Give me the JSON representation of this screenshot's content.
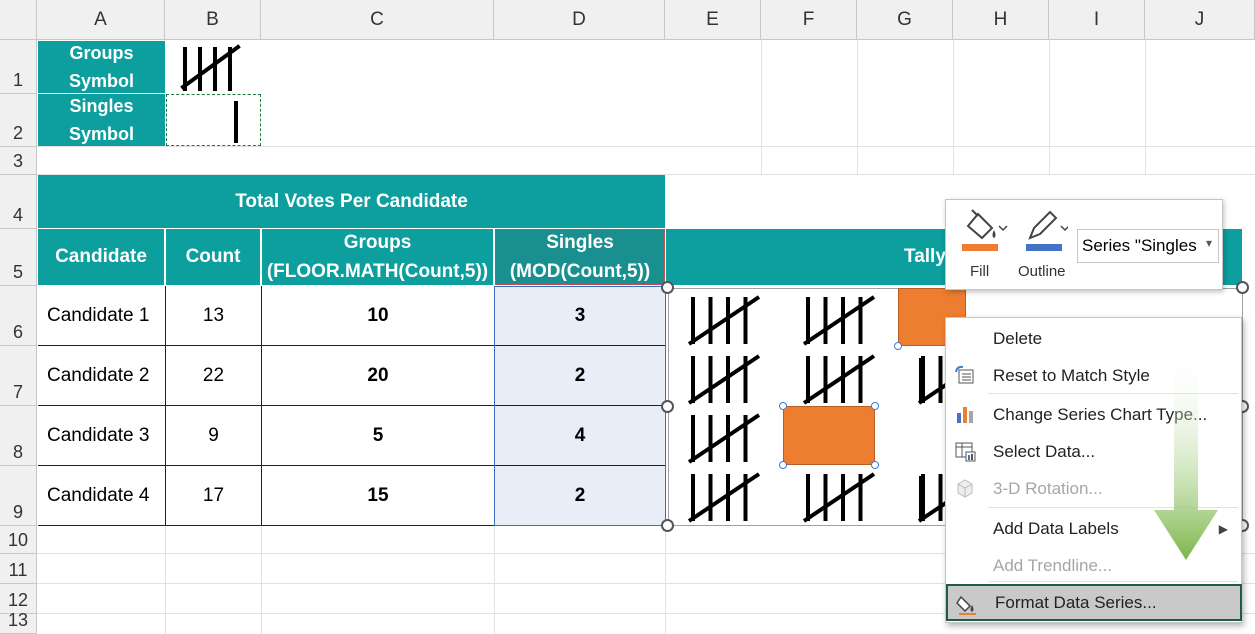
{
  "columns": [
    "A",
    "B",
    "C",
    "D",
    "E",
    "F",
    "G",
    "H",
    "I",
    "J"
  ],
  "rows": [
    "1",
    "2",
    "3",
    "4",
    "5",
    "6",
    "7",
    "8",
    "9",
    "10",
    "11",
    "12",
    "13"
  ],
  "symbols": {
    "groups_label_1": "Groups",
    "groups_label_2": "Symbol",
    "singles_label_1": "Singles",
    "singles_label_2": "Symbol"
  },
  "table": {
    "title": "Total Votes Per Candidate",
    "headers": {
      "candidate": "Candidate",
      "count": "Count",
      "groups_1": "Groups",
      "groups_2": "(FLOOR.MATH(Count,5))",
      "singles_1": "Singles",
      "singles_2": "(MOD(Count,5))"
    },
    "rows": [
      {
        "candidate": "Candidate 1",
        "count": "13",
        "groups": "10",
        "singles": "3"
      },
      {
        "candidate": "Candidate 2",
        "count": "22",
        "groups": "20",
        "singles": "2"
      },
      {
        "candidate": "Candidate 3",
        "count": "9",
        "groups": "5",
        "singles": "4"
      },
      {
        "candidate": "Candidate 4",
        "count": "17",
        "groups": "15",
        "singles": "2"
      }
    ]
  },
  "tally_header": "Tally",
  "toolbar": {
    "fill_label": "Fill",
    "outline_label": "Outline",
    "series_value": "Series \"Singles",
    "fill_color": "#ed7d31",
    "outline_color": "#4472c4"
  },
  "context_menu": [
    {
      "label": "Delete",
      "icon": "none",
      "enabled": true
    },
    {
      "label": "Reset to Match Style",
      "icon": "reset-style-icon",
      "enabled": true
    },
    {
      "label": "Change Series Chart Type...",
      "icon": "bar-chart-icon",
      "enabled": true
    },
    {
      "label": "Select Data...",
      "icon": "select-data-icon",
      "enabled": true
    },
    {
      "label": "3-D Rotation...",
      "icon": "cube-icon",
      "enabled": false
    },
    {
      "label": "Add Data Labels",
      "icon": "none",
      "enabled": true,
      "submenu": true
    },
    {
      "label": "Add Trendline...",
      "icon": "none",
      "enabled": false
    },
    {
      "label": "Format Data Series...",
      "icon": "format-paint-icon",
      "enabled": true,
      "highlighted": true
    }
  ],
  "colors": {
    "teal": "#0d9e9e",
    "orange": "#ed7d31",
    "arrow_green": "#7ab648"
  }
}
